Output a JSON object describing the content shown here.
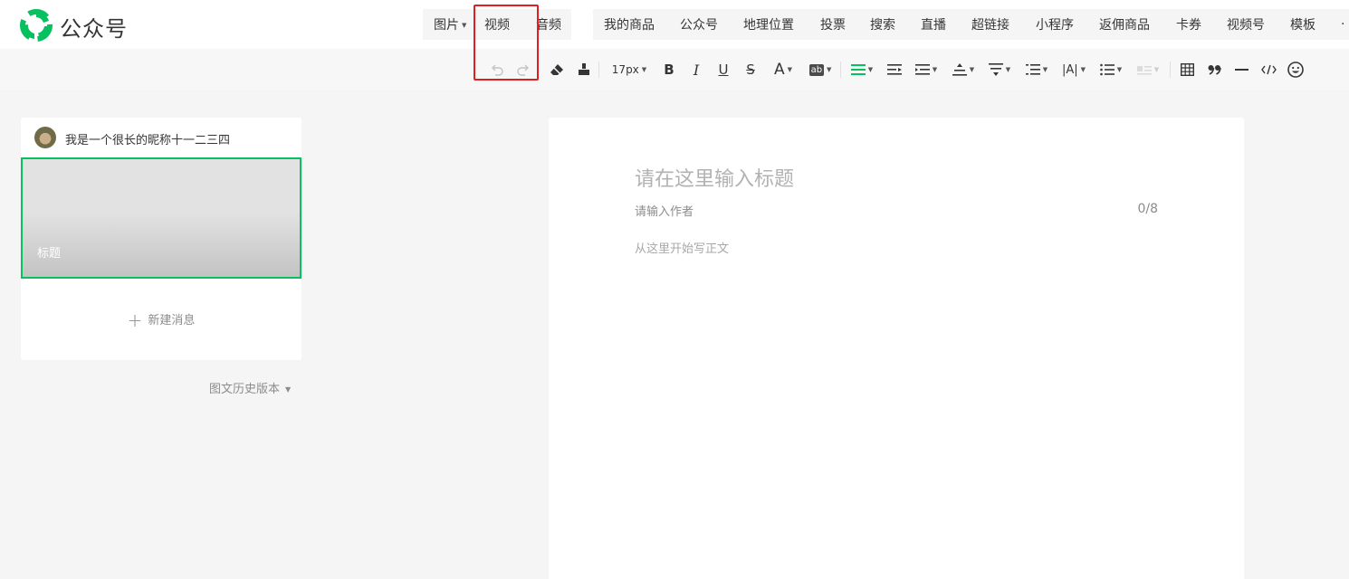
{
  "app": {
    "brand": "公众号"
  },
  "insert_menu": {
    "group1": [
      {
        "label": "图片",
        "has_caret": true
      },
      {
        "label": "视频",
        "has_caret": false
      },
      {
        "label": "音频",
        "has_caret": false
      }
    ],
    "group2": [
      {
        "label": "我的商品"
      },
      {
        "label": "公众号"
      },
      {
        "label": "地理位置"
      },
      {
        "label": "投票"
      },
      {
        "label": "搜索"
      },
      {
        "label": "直播"
      },
      {
        "label": "超链接"
      },
      {
        "label": "小程序"
      },
      {
        "label": "返佣商品"
      },
      {
        "label": "卡券"
      },
      {
        "label": "视频号"
      },
      {
        "label": "模板"
      }
    ],
    "more": "·"
  },
  "toolbar": {
    "font_size": "17px",
    "bold": "B",
    "italic": "I",
    "underline": "U",
    "strike": "S",
    "font_color": "A",
    "background_color": "ab",
    "letter_spacing": "|A|",
    "icons": [
      "undo-icon",
      "redo-icon",
      "eraser-icon",
      "format-painter-icon",
      "align-icon",
      "indent-icon",
      "text-indent-icon",
      "line-height-icon",
      "paragraph-spacing-icon",
      "list-icon",
      "table-icon",
      "quote-icon",
      "divider-icon",
      "code-icon",
      "emoji-icon"
    ],
    "accent_color": "#07c160"
  },
  "article_list": {
    "nickname": "我是一个很长的昵称十一二三四",
    "cover_title": "标题",
    "new_message": "新建消息",
    "history": "图文历史版本"
  },
  "editor": {
    "title_placeholder": "请在这里输入标题",
    "author_placeholder": "请输入作者",
    "author_count": "0/8",
    "body_placeholder": "从这里开始写正文"
  },
  "colors": {
    "highlight": "#e02020",
    "brand_green": "#07c160"
  }
}
